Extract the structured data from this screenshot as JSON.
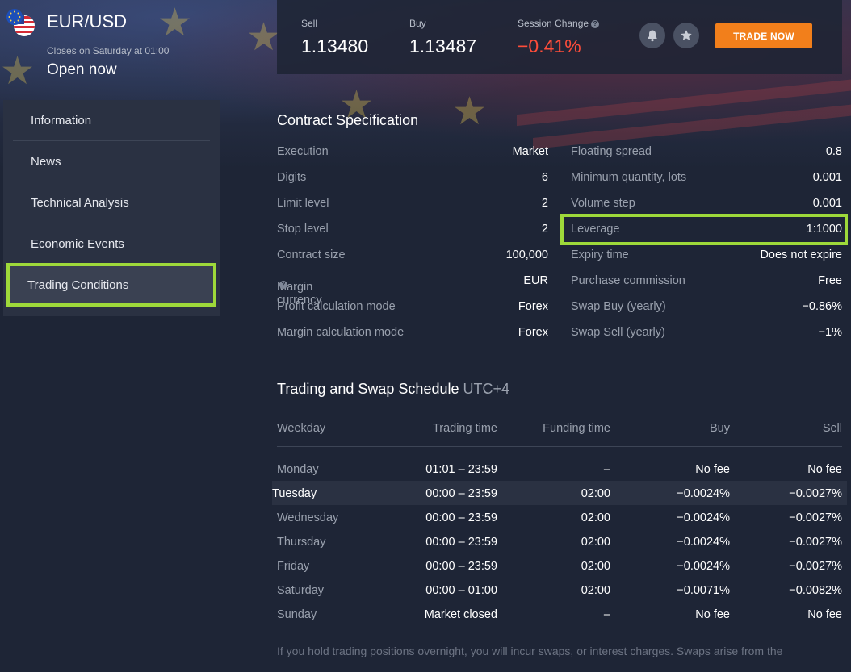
{
  "instrument": {
    "symbol": "EUR/USD",
    "closes_text": "Closes on Saturday at 01:00",
    "status": "Open now"
  },
  "quote": {
    "sell_label": "Sell",
    "sell_value": "1.13480",
    "buy_label": "Buy",
    "buy_value": "1.13487",
    "change_label": "Session Change",
    "change_value": "−0.41%",
    "change_color": "#ff4d3a",
    "trade_button": "TRADE NOW",
    "bell_icon": "bell-icon",
    "star_icon": "star-icon",
    "help_icon": "?"
  },
  "sidebar": {
    "items": [
      {
        "label": "Information"
      },
      {
        "label": "News"
      },
      {
        "label": "Technical Analysis"
      },
      {
        "label": "Economic Events"
      },
      {
        "label": "Trading Conditions",
        "active": true
      }
    ]
  },
  "contract": {
    "title": "Contract Specification",
    "left": [
      {
        "label": "Execution",
        "value": "Market"
      },
      {
        "label": "Digits",
        "value": "6"
      },
      {
        "label": "Limit level",
        "value": "2"
      },
      {
        "label": "Stop level",
        "value": "2"
      },
      {
        "label": "Contract size",
        "value": "100,000"
      },
      {
        "label": "Margin currency",
        "value": "EUR"
      },
      {
        "label": "Profit calculation mode",
        "value": "Forex"
      },
      {
        "label": "Margin calculation mode",
        "value": "Forex"
      }
    ],
    "right": [
      {
        "label": "Floating spread",
        "value": "0.8"
      },
      {
        "label": "Minimum quantity, lots",
        "value": "0.001"
      },
      {
        "label": "Volume step",
        "value": "0.001"
      },
      {
        "label": "Leverage",
        "value": "1:1000"
      },
      {
        "label": "Expiry time",
        "value": "Does not expire"
      },
      {
        "label": "Purchase commission",
        "value": "Free"
      },
      {
        "label": "Swap Buy (yearly)",
        "value": "−0.86%"
      },
      {
        "label": "Swap Sell (yearly)",
        "value": "−1%"
      }
    ]
  },
  "schedule": {
    "title": "Trading and Swap Schedule",
    "timezone": "UTC+4",
    "headers": [
      "Weekday",
      "Trading time",
      "Funding time",
      "Buy",
      "Sell"
    ],
    "rows": [
      [
        "Monday",
        "01:01 – 23:59",
        "–",
        "No fee",
        "No fee"
      ],
      [
        "Tuesday",
        "00:00 – 23:59",
        "02:00",
        "−0.0024%",
        "−0.0027%"
      ],
      [
        "Wednesday",
        "00:00 – 23:59",
        "02:00",
        "−0.0024%",
        "−0.0027%"
      ],
      [
        "Thursday",
        "00:00 – 23:59",
        "02:00",
        "−0.0024%",
        "−0.0027%"
      ],
      [
        "Friday",
        "00:00 – 23:59",
        "02:00",
        "−0.0024%",
        "−0.0027%"
      ],
      [
        "Saturday",
        "00:00 – 01:00",
        "02:00",
        "−0.0071%",
        "−0.0082%"
      ],
      [
        "Sunday",
        "Market closed",
        "–",
        "No fee",
        "No fee"
      ]
    ],
    "highlight_row": 1
  },
  "note": "If you hold trading positions overnight, you will incur swaps, or interest charges. Swaps arise from the",
  "colors": {
    "accent_highlight": "#9ed93a",
    "trade_button": "#f27f1b",
    "background": "#1e2536"
  }
}
